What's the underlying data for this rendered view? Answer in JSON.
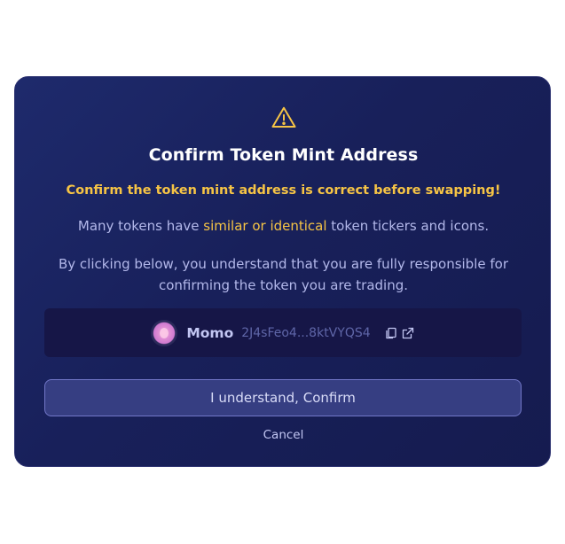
{
  "modal": {
    "title": "Confirm Token Mint Address",
    "warning": "Confirm the token mint address is correct before swapping!",
    "desc1_pre": "Many tokens have ",
    "desc1_highlight": "similar or identical",
    "desc1_post": " token tickers and icons.",
    "desc2": "By clicking below, you understand that you are fully responsible for confirming the token you are trading.",
    "token": {
      "name": "Momo",
      "address": "2J4sFeo4...8ktVYQS4",
      "icons": [
        "copy-icon",
        "external-link-icon"
      ]
    },
    "confirm_label": "I understand, Confirm",
    "cancel_label": "Cancel"
  },
  "colors": {
    "accent_yellow": "#f6c445",
    "modal_bg": "#18205a",
    "text_muted": "#b3b8ea"
  }
}
